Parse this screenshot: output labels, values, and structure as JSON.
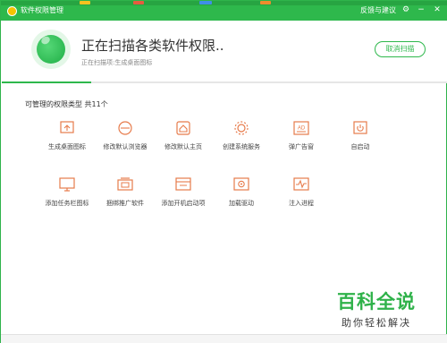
{
  "window": {
    "title": "软件权限管理",
    "feedback": "反馈与建议",
    "settings_icon": "gear-icon",
    "minimize_icon": "minimize-icon",
    "close_icon": "close-icon"
  },
  "header": {
    "scan_title": "正在扫描各类软件权限..",
    "scan_subtitle": "正在扫描项:生成桌面图标",
    "cancel_label": "取消扫描",
    "progress": 0.2
  },
  "section": {
    "label": "可管理的权限类型 共11个"
  },
  "permissions": [
    {
      "label": "生成桌面图标",
      "icon": "desktop-shortcut-icon"
    },
    {
      "label": "修改默认浏览器",
      "icon": "browser-icon"
    },
    {
      "label": "修改默认主页",
      "icon": "home-icon"
    },
    {
      "label": "创建系统服务",
      "icon": "service-gear-icon"
    },
    {
      "label": "弹广告窗",
      "icon": "ad-icon"
    },
    {
      "label": "自启动",
      "icon": "power-icon"
    },
    {
      "label": "添加任务栏图标",
      "icon": "taskbar-icon"
    },
    {
      "label": "捆绑推广软件",
      "icon": "bundle-icon"
    },
    {
      "label": "添加开机启动项",
      "icon": "startup-item-icon"
    },
    {
      "label": "加载驱动",
      "icon": "driver-icon"
    },
    {
      "label": "注入进程",
      "icon": "process-icon"
    }
  ],
  "watermark": {
    "logo": "百科全说",
    "tagline": "助你轻松解决"
  },
  "colors": {
    "accent": "#2eb84c",
    "icon": "#e77b4b"
  }
}
